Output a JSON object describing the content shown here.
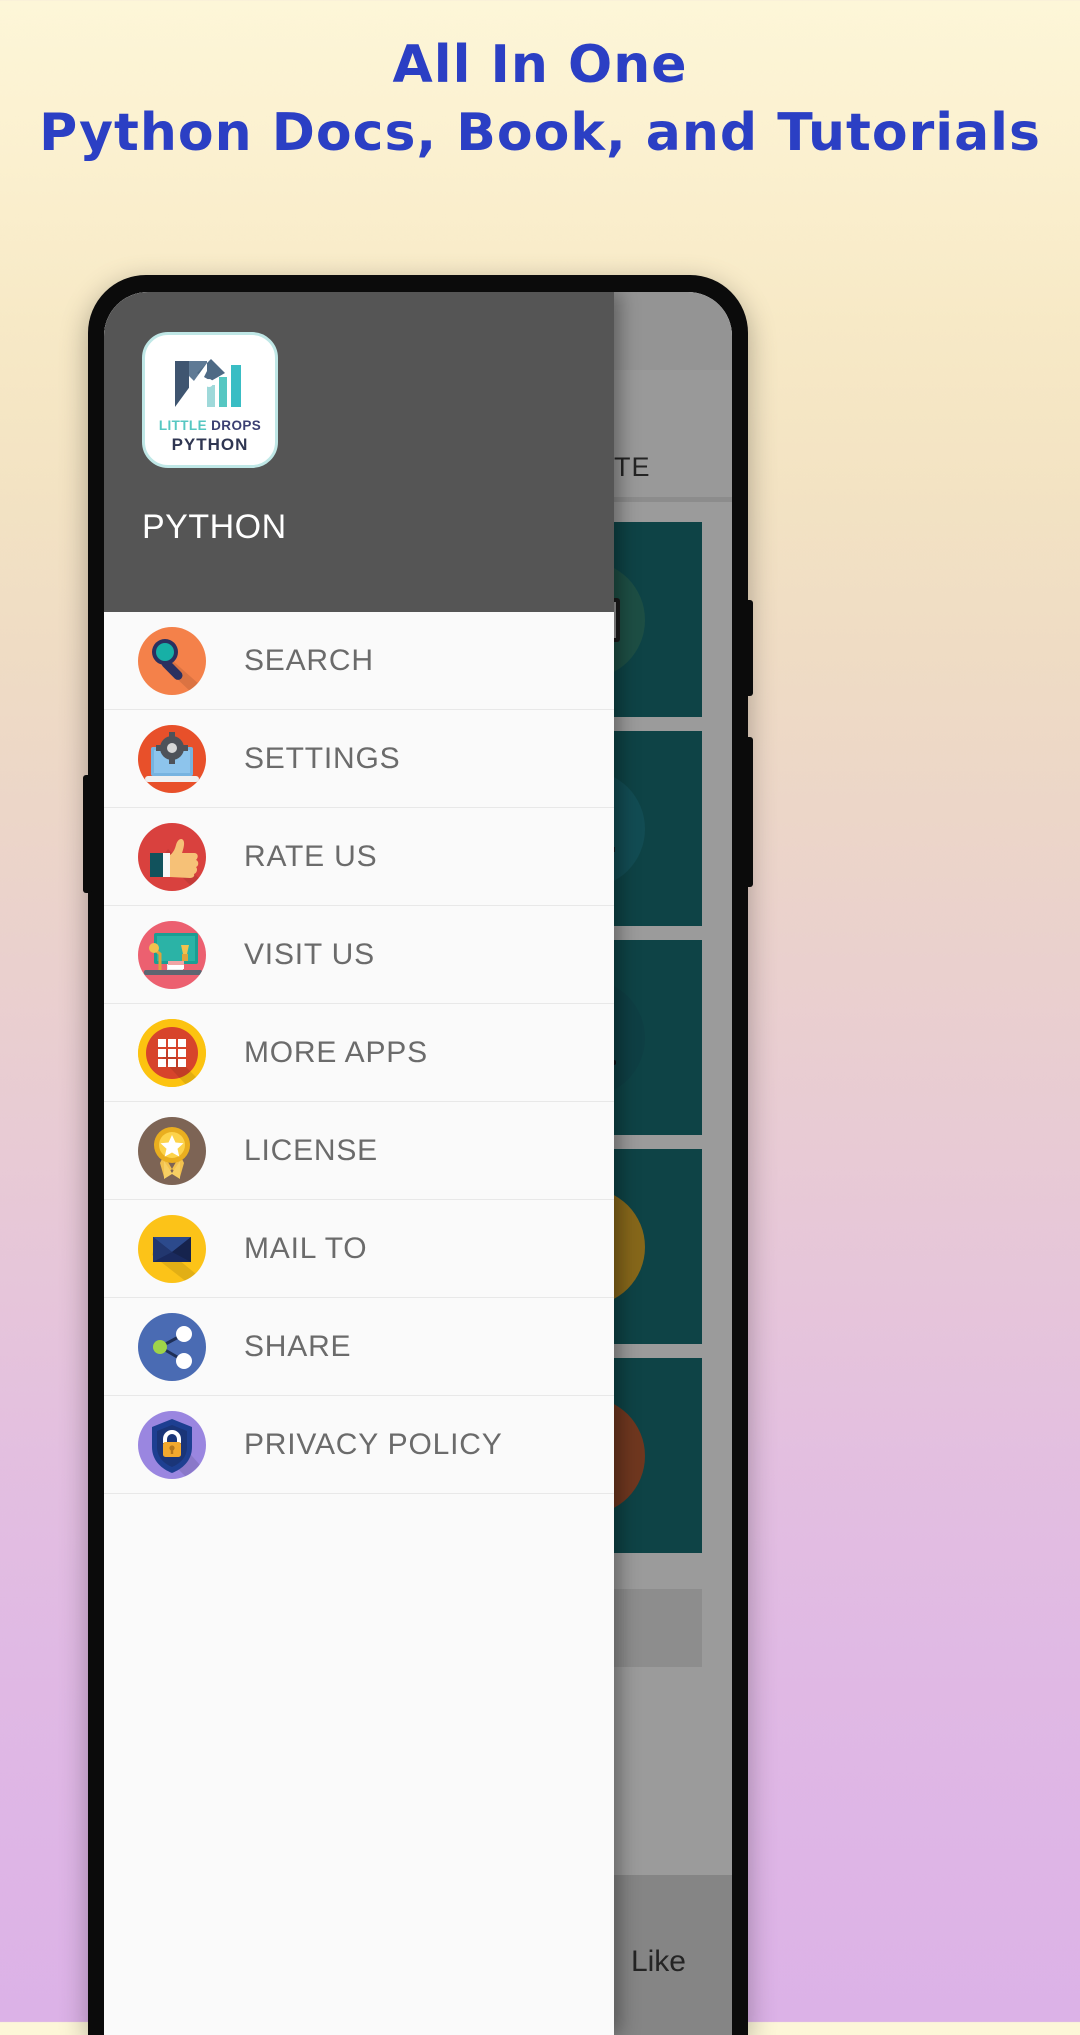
{
  "promo": {
    "line1": "All In One",
    "line2": "Python Docs, Book, and Tutorials",
    "text_color": "#2b3fc4"
  },
  "phone": {
    "app_screen": {
      "tab": {
        "label": "VOURITE",
        "full_label": "FAVOURITE",
        "icon": "heart-icon",
        "icon_color": "#c62828"
      },
      "tiles": [
        {
          "badge": "open-book-icon",
          "badge_color": "#2f7f6f",
          "tile_color": "#186d72"
        },
        {
          "badge": "books-stack-icon",
          "badge_color": "#1e7b86",
          "tile_color": "#186d72"
        },
        {
          "badge": "person-laptop-icon",
          "badge_color": "#17666e",
          "tile_color": "#186d72"
        },
        {
          "badge": "library-books-icon",
          "badge_color": "#d8a72b",
          "tile_color": "#186d72"
        },
        {
          "badge": "magnifier-icon",
          "badge_color": "#b45a32",
          "tile_color": "#186d72"
        }
      ],
      "bottom_label": "Like"
    },
    "drawer": {
      "logo": {
        "line1_part1": "LITTLE",
        "line1_part2": "DROPS",
        "line2": "PYTHON",
        "part1_color": "#56c7c2",
        "part2_color": "#3b3f72"
      },
      "app_name": "PYTHON",
      "header_bg": "#555555",
      "items": [
        {
          "label": "SEARCH",
          "icon": "search-icon",
          "color": "#f4814a"
        },
        {
          "label": "SETTINGS",
          "icon": "settings-icon",
          "color": "#e8502a"
        },
        {
          "label": "RATE US",
          "icon": "thumbs-up-icon",
          "color": "#d9413e"
        },
        {
          "label": "VISIT US",
          "icon": "desktop-icon",
          "color": "#ec6070"
        },
        {
          "label": "MORE APPS",
          "icon": "grid-apps-icon",
          "color": "#fcc310"
        },
        {
          "label": "LICENSE",
          "icon": "medal-icon",
          "color": "#7d6455"
        },
        {
          "label": "MAIL TO",
          "icon": "envelope-icon",
          "color": "#fcc318"
        },
        {
          "label": "SHARE",
          "icon": "share-icon",
          "color": "#4a6bb3"
        },
        {
          "label": "PRIVACY POLICY",
          "icon": "shield-lock-icon",
          "color": "#9a86e0"
        }
      ]
    }
  }
}
